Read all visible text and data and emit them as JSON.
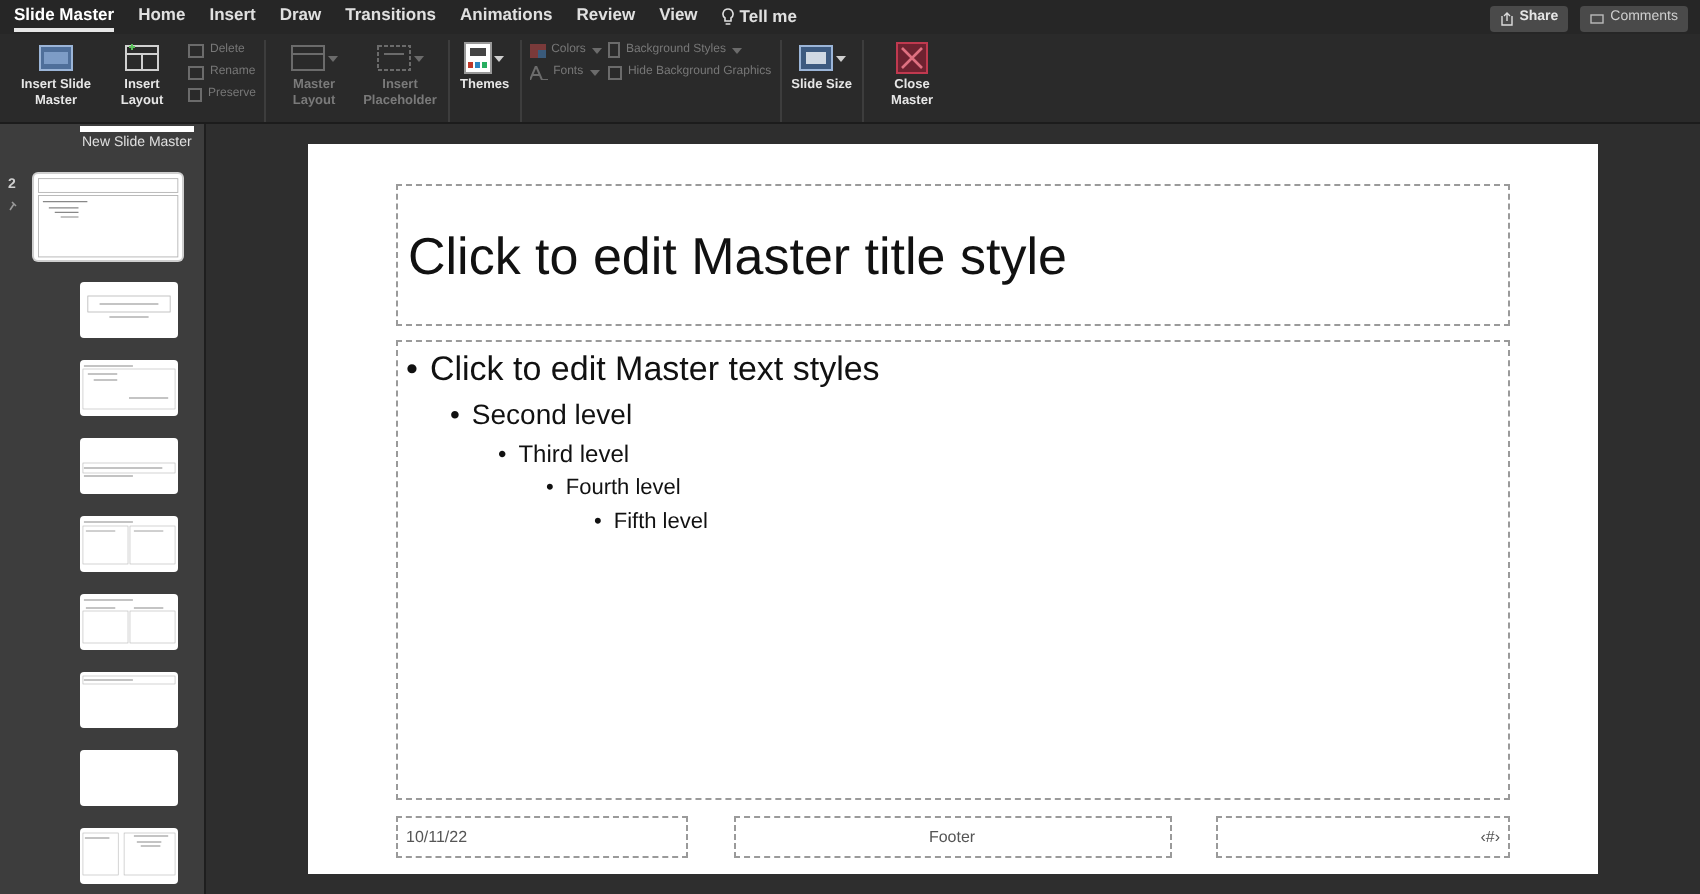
{
  "tabs": [
    {
      "label": "Slide Master",
      "selected": true
    },
    {
      "label": "Home",
      "selected": false
    },
    {
      "label": "Insert",
      "selected": false
    },
    {
      "label": "Draw",
      "selected": false
    },
    {
      "label": "Transitions",
      "selected": false
    },
    {
      "label": "Animations",
      "selected": false
    },
    {
      "label": "Review",
      "selected": false
    },
    {
      "label": "View",
      "selected": false
    }
  ],
  "tell_me": "Tell me",
  "share_button": "Share",
  "comments_button": "Comments",
  "ribbon": [
    {
      "items": [
        {
          "kind": "large",
          "label": "Insert Slide Master",
          "disabled": false,
          "dropdown": false
        },
        {
          "kind": "large",
          "label": "Insert Layout",
          "disabled": false,
          "dropdown": false
        },
        {
          "kind": "stack",
          "items": [
            {
              "kind": "small",
              "label": "Delete",
              "disabled": true,
              "dropdown": false
            },
            {
              "kind": "small",
              "label": "Rename",
              "disabled": true,
              "dropdown": false
            },
            {
              "kind": "checkbox",
              "label": "Preserve",
              "disabled": true,
              "checked": false
            }
          ]
        }
      ]
    },
    {
      "items": [
        {
          "kind": "large",
          "label": "Master Layout",
          "disabled": true,
          "dropdown": true
        },
        {
          "kind": "large",
          "label": "Insert Placeholder",
          "disabled": true,
          "dropdown": true
        }
      ]
    },
    {
      "items": [
        {
          "kind": "large",
          "label": "Themes",
          "disabled": false,
          "dropdown": true
        }
      ]
    },
    {
      "items": [
        {
          "kind": "stack",
          "items": [
            {
              "kind": "small",
              "label": "Colors",
              "disabled": true,
              "dropdown": true
            },
            {
              "kind": "small",
              "label": "Fonts",
              "disabled": true,
              "dropdown": true
            }
          ]
        },
        {
          "kind": "stack",
          "items": [
            {
              "kind": "small",
              "label": "Background Styles",
              "disabled": true,
              "dropdown": true
            },
            {
              "kind": "checkbox",
              "label": "Hide Background Graphics",
              "disabled": true,
              "checked": false
            }
          ]
        }
      ]
    },
    {
      "items": [
        {
          "kind": "large",
          "label": "Slide Size",
          "disabled": false,
          "dropdown": true
        }
      ]
    },
    {
      "items": [
        {
          "kind": "large",
          "label": "Close Master",
          "disabled": false,
          "dropdown": false
        }
      ]
    }
  ],
  "tooltip": "New Slide Master",
  "thumbnails": [
    {
      "kind": "master",
      "number": "2"
    },
    {
      "kind": "title"
    },
    {
      "kind": "content"
    },
    {
      "kind": "section"
    },
    {
      "kind": "two-content"
    },
    {
      "kind": "comparison"
    },
    {
      "kind": "title-only"
    },
    {
      "kind": "blank"
    },
    {
      "kind": "caption"
    }
  ],
  "slide": {
    "title": "Click to edit Master title style",
    "body": [
      {
        "bullet": "•",
        "text": "Click to edit Master text styles",
        "children": [
          {
            "bullet": "•",
            "text": "Second level",
            "children": [
              {
                "bullet": "•",
                "text": "Third level",
                "children": [
                  {
                    "bullet": "•",
                    "text": "Fourth level",
                    "children": [
                      {
                        "bullet": "•",
                        "text": "Fifth level"
                      }
                    ]
                  }
                ]
              }
            ]
          }
        ]
      }
    ],
    "footer": {
      "date": "10/11/22",
      "footer": "Footer",
      "number": "‹#›"
    }
  }
}
